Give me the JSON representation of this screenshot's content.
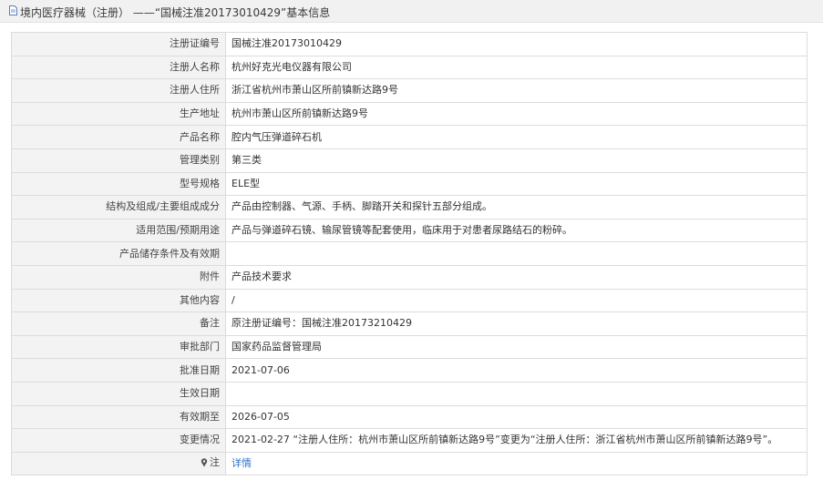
{
  "header": {
    "icon": "document-icon",
    "title": "境内医疗器械（注册） ——“国械注准20173010429”基本信息"
  },
  "rows": [
    {
      "label": "注册证编号",
      "value": "国械注准20173010429"
    },
    {
      "label": "注册人名称",
      "value": "杭州好克光电仪器有限公司"
    },
    {
      "label": "注册人住所",
      "value": "浙江省杭州市萧山区所前镇新达路9号"
    },
    {
      "label": "生产地址",
      "value": "杭州市萧山区所前镇新达路9号"
    },
    {
      "label": "产品名称",
      "value": "腔内气压弹道碎石机"
    },
    {
      "label": "管理类别",
      "value": "第三类"
    },
    {
      "label": "型号规格",
      "value": "ELE型"
    },
    {
      "label": "结构及组成/主要组成成分",
      "value": "产品由控制器、气源、手柄、脚踏开关和探针五部分组成。"
    },
    {
      "label": "适用范围/预期用途",
      "value": "产品与弹道碎石镜、输尿管镜等配套使用，临床用于对患者尿路结石的粉碎。"
    },
    {
      "label": "产品储存条件及有效期",
      "value": ""
    },
    {
      "label": "附件",
      "value": "产品技术要求"
    },
    {
      "label": "其他内容",
      "value": "/"
    },
    {
      "label": "备注",
      "value": "原注册证编号：国械注准20173210429"
    },
    {
      "label": "审批部门",
      "value": "国家药品监督管理局"
    },
    {
      "label": "批准日期",
      "value": "2021-07-06"
    },
    {
      "label": "生效日期",
      "value": ""
    },
    {
      "label": "有效期至",
      "value": "2026-07-05"
    },
    {
      "label": "变更情况",
      "value": "2021-02-27 “注册人住所：杭州市萧山区所前镇新达路9号”变更为“注册人住所：浙江省杭州市萧山区所前镇新达路9号”。"
    }
  ],
  "note_row": {
    "icon": "pin-icon",
    "label": "注",
    "link": "详情"
  },
  "colors": {
    "link": "#2c73c6",
    "label_bg": "#f3f3f3",
    "border": "#dcdcdc",
    "header_bg": "#f1f1f1"
  }
}
